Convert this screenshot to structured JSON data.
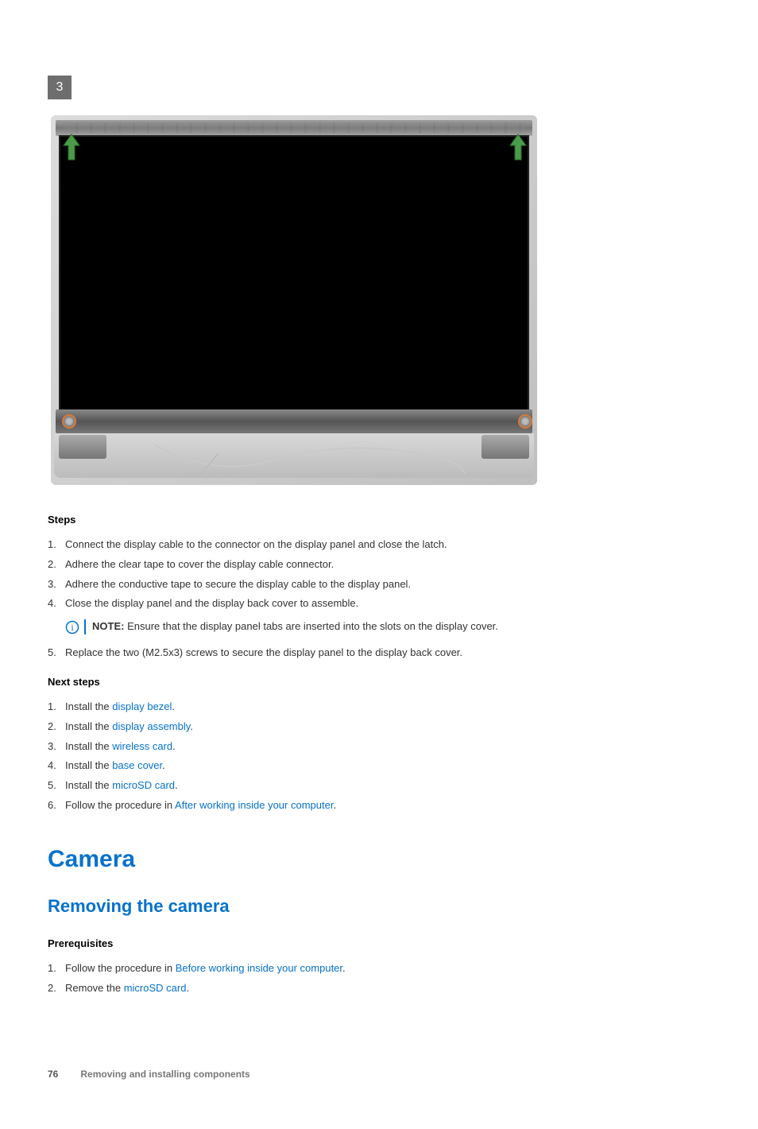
{
  "figure": {
    "badge": "3"
  },
  "steps_label": "Steps",
  "steps": [
    "Connect the display cable to the connector on the display panel and close the latch.",
    "Adhere the clear tape to cover the display cable connector.",
    "Adhere the conductive tape to secure the display cable to the display panel.",
    "Close the display panel and the display back cover to assemble."
  ],
  "note": {
    "label": "NOTE:",
    "text": " Ensure that the display panel tabs are inserted into the slots on the display cover."
  },
  "step5": "Replace the two (M2.5x3) screws to secure the display panel to the display back cover.",
  "next_label": "Next steps",
  "next": [
    {
      "pre": "Install the ",
      "link": "display bezel",
      "post": "."
    },
    {
      "pre": "Install the ",
      "link": "display assembly",
      "post": "."
    },
    {
      "pre": "Install the ",
      "link": "wireless card",
      "post": "."
    },
    {
      "pre": "Install the ",
      "link": "base cover",
      "post": "."
    },
    {
      "pre": "Install the ",
      "link": "microSD card",
      "post": "."
    },
    {
      "pre": "Follow the procedure in ",
      "link": "After working inside your computer",
      "post": "."
    }
  ],
  "h1": "Camera",
  "h2": "Removing the camera",
  "prereq_label": "Prerequisites",
  "prereq": [
    {
      "pre": "Follow the procedure in ",
      "link": "Before working inside your computer",
      "post": "."
    },
    {
      "pre": "Remove the ",
      "link": "microSD card",
      "post": "."
    }
  ],
  "footer": {
    "page": "76",
    "text": "Removing and installing components"
  }
}
